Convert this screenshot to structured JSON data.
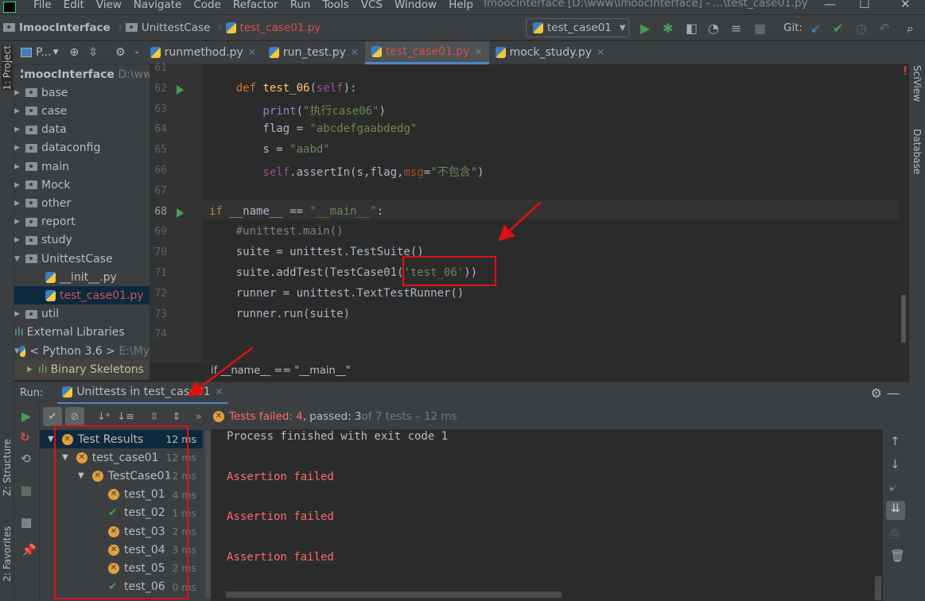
{
  "menu": [
    "File",
    "Edit",
    "View",
    "Navigate",
    "Code",
    "Refactor",
    "Run",
    "Tools",
    "VCS",
    "Window",
    "Help"
  ],
  "window_title": "ImoocInterface [D:\\www\\ImoocInterface] - ...\\test_case01.py",
  "breadcrumbs": [
    "ImoocInterface",
    "UnittestCase",
    "test_case01.py"
  ],
  "run_config": "test_case01",
  "git_label": "Git:",
  "project_selector": "P...",
  "tabs": [
    {
      "label": "runmethod.py"
    },
    {
      "label": "run_test.py"
    },
    {
      "label": "test_case01.py",
      "active": true
    },
    {
      "label": "mock_study.py"
    }
  ],
  "left_stripe": {
    "project": "1: Project",
    "structure": "Z: Structure",
    "favorites": "2: Favorites"
  },
  "right_stripe": {
    "sciview": "SciView",
    "database": "Database"
  },
  "project_tree": {
    "root": {
      "label": "ImoocInterface",
      "path": "D:\\www"
    },
    "items": [
      {
        "label": "base"
      },
      {
        "label": "case"
      },
      {
        "label": "data"
      },
      {
        "label": "dataconfig"
      },
      {
        "label": "main"
      },
      {
        "label": "Mock"
      },
      {
        "label": "other"
      },
      {
        "label": "report"
      },
      {
        "label": "study"
      },
      {
        "label": "UnittestCase",
        "expanded": true
      }
    ],
    "children": [
      "__init__.py",
      "test_case01.py"
    ],
    "util": "util",
    "external": "External Libraries",
    "python": {
      "label": "< Python 3.6 >",
      "path": "E:\\My"
    },
    "binary": "Binary Skeletons"
  },
  "editor": {
    "line_numbers": [
      "61",
      "62",
      "63",
      "64",
      "65",
      "66",
      "67",
      "68",
      "69",
      "70",
      "71",
      "72",
      "73",
      "74"
    ],
    "lines": [
      [],
      [
        [
          "kw",
          "    def "
        ],
        [
          "fn",
          "test_06"
        ],
        [
          "df",
          "("
        ],
        [
          "sf",
          "self"
        ],
        [
          "df",
          "):"
        ]
      ],
      [
        [
          "bi",
          "        print"
        ],
        [
          "df",
          "("
        ],
        [
          "st",
          "\"执行case06\""
        ],
        [
          "df",
          ")"
        ]
      ],
      [
        [
          "df",
          "        flag = "
        ],
        [
          "st",
          "\"abcdefgaabdedg\""
        ]
      ],
      [
        [
          "df",
          "        s = "
        ],
        [
          "st",
          "\"aabd\""
        ]
      ],
      [
        [
          "sf",
          "        self"
        ],
        [
          "df",
          ".assertIn(s,flag,"
        ],
        [
          "pm",
          "msg"
        ],
        [
          "df",
          "="
        ],
        [
          "st",
          "\"不包含\""
        ],
        [
          "df",
          ")"
        ]
      ],
      [],
      [
        [
          "kw",
          "if "
        ],
        [
          "df",
          "__name__ == "
        ],
        [
          "st",
          "\"__main__\""
        ],
        [
          "df",
          ":"
        ]
      ],
      [
        [
          "cm",
          "    #unittest.main()"
        ]
      ],
      [
        [
          "df",
          "    suite = unittest.TestSuite()"
        ]
      ],
      [
        [
          "df",
          "    suite.addTest(TestCase01("
        ],
        [
          "st",
          "'test_06'"
        ],
        [
          "df",
          "))"
        ]
      ],
      [
        [
          "df",
          "    runner = unittest.TextTestRunner()"
        ]
      ],
      [
        [
          "df",
          "    runner.run(suite)"
        ]
      ],
      []
    ],
    "breadcrumb": "if __name__ == \"__main__\""
  },
  "run": {
    "label": "Run:",
    "tab": "Unittests in test_case01",
    "summary": {
      "failed": "Tests failed: 4",
      "passed": ", passed: 3",
      "total": " of 7 tests – 12 ms"
    },
    "tree": [
      {
        "label": "Test Results",
        "time": "12 ms",
        "status": "failed",
        "level": 0
      },
      {
        "label": "test_case01",
        "time": "12 ms",
        "status": "failed",
        "level": 1
      },
      {
        "label": "TestCase01",
        "time": "12 ms",
        "status": "failed",
        "level": 2
      },
      {
        "label": "test_01",
        "time": "4 ms",
        "status": "failed",
        "level": 3
      },
      {
        "label": "test_02",
        "time": "1 ms",
        "status": "passed",
        "level": 3
      },
      {
        "label": "test_03",
        "time": "2 ms",
        "status": "failed",
        "level": 3
      },
      {
        "label": "test_04",
        "time": "3 ms",
        "status": "failed",
        "level": 3
      },
      {
        "label": "test_05",
        "time": "2 ms",
        "status": "failed",
        "level": 3
      },
      {
        "label": "test_06",
        "time": "0 ms",
        "status": "passed",
        "level": 3
      }
    ],
    "console": [
      "Process finished with exit code 1",
      "Assertion failed",
      "Assertion failed",
      "Assertion failed"
    ]
  },
  "colors": {
    "accent": "#4a88c7",
    "failed": "#e0a03c",
    "passed": "#499c54",
    "error_text": "#ff6b68",
    "annotation": "#e01010"
  }
}
